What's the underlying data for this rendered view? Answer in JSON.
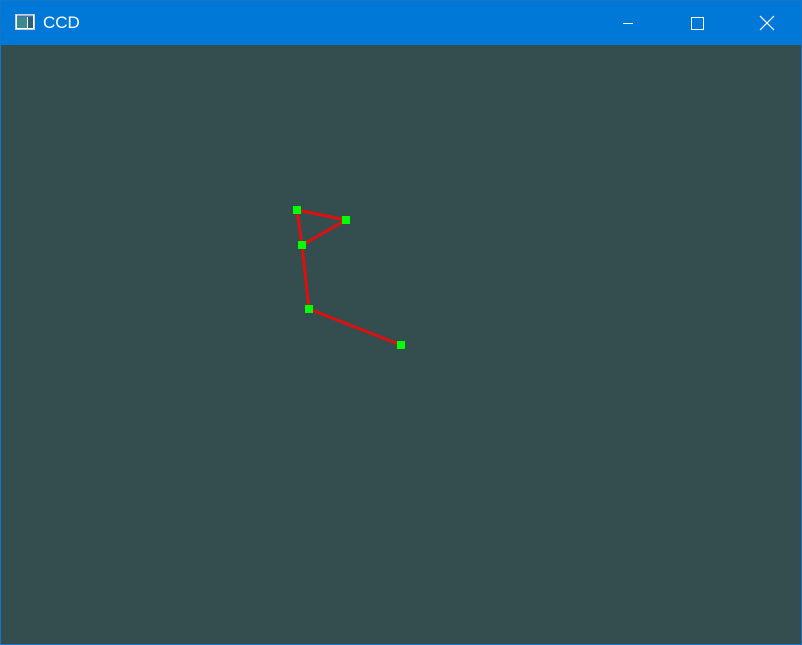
{
  "window": {
    "title": "CCD",
    "app_icon": "window-app-icon",
    "controls": {
      "minimize_icon": "minimize-icon",
      "maximize_icon": "maximize-icon",
      "close_icon": "close-icon"
    }
  },
  "colors": {
    "titlebar": "#0078d7",
    "canvas_background": "#344e4f",
    "link_color": "#e00f0f",
    "joint_color": "#00ff00"
  }
}
